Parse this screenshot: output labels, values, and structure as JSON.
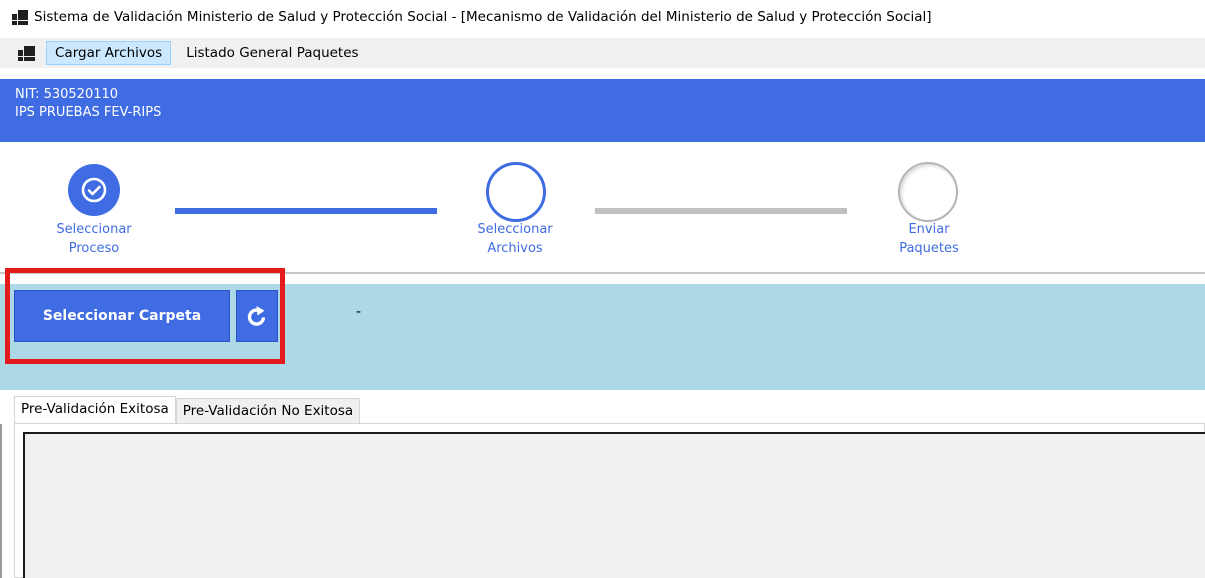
{
  "window": {
    "title": "Sistema de Validación Ministerio de Salud y Protección Social - [Mecanismo de Validación del Ministerio de Salud y Protección Social]"
  },
  "menu": {
    "items": [
      {
        "label": "Cargar Archivos",
        "active": true
      },
      {
        "label": "Listado General Paquetes",
        "active": false
      }
    ]
  },
  "header": {
    "nit": "NIT: 530520110",
    "name": "IPS PRUEBAS FEV-RIPS"
  },
  "stepper": {
    "steps": [
      {
        "line1": "Seleccionar",
        "line2": "Proceso",
        "state": "completed"
      },
      {
        "line1": "Seleccionar",
        "line2": "Archivos",
        "state": "current"
      },
      {
        "line1": "Enviar",
        "line2": "Paquetes",
        "state": "pending"
      }
    ]
  },
  "actions": {
    "select_folder_label": "Seleccionar Carpeta",
    "refresh_icon": "refresh-icon",
    "folder_path": "-"
  },
  "tabs": [
    {
      "label": "Pre-Validación Exitosa",
      "active": true
    },
    {
      "label": "Pre-Validación No Exitosa",
      "active": false
    }
  ],
  "colors": {
    "primary": "#3f6ce3",
    "band": "#add8e6",
    "highlight": "#e31b1b",
    "inactive_line": "#c0c0c0",
    "inactive_circle": "#b5b5b5"
  }
}
